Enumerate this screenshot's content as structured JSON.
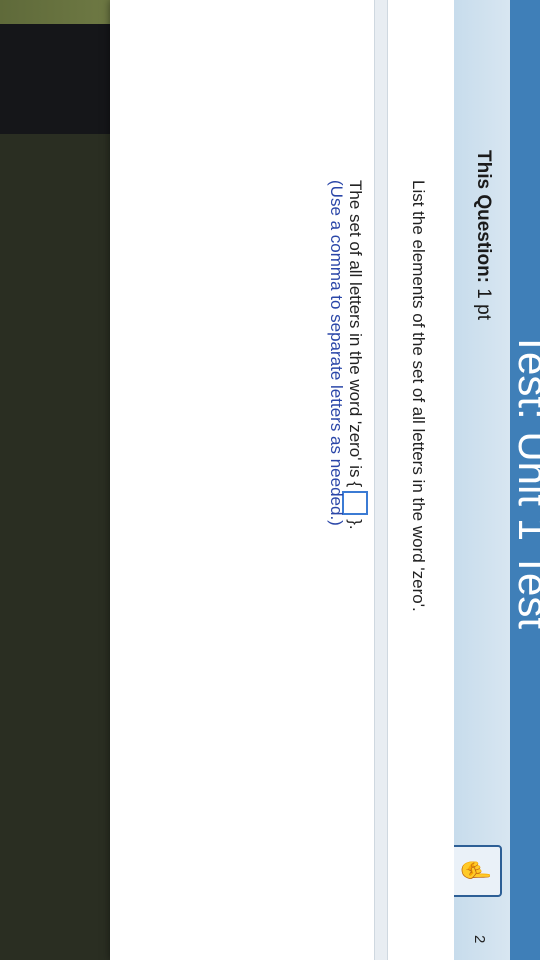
{
  "header": {
    "title": "Test: Unit 1 Test"
  },
  "question_bar": {
    "label_bold": "This Question:",
    "label_value": "1 pt",
    "question_number": "2"
  },
  "question": {
    "prompt": "List the elements of the set of all letters in the word 'zero'.",
    "statement_prefix": "The set of all letters in the word 'zero' is",
    "brace_open": "{",
    "brace_close": "}.",
    "hint": "(Use a comma to separate letters as needed.)"
  },
  "answer": {
    "value": ""
  },
  "icons": {
    "help": "hand-pointer-icon"
  },
  "colors": {
    "title_bar": "#3f7fb8",
    "question_bar": "#c7dcec",
    "hint_text": "#2a46a8",
    "answer_border": "#3b7bd4"
  }
}
